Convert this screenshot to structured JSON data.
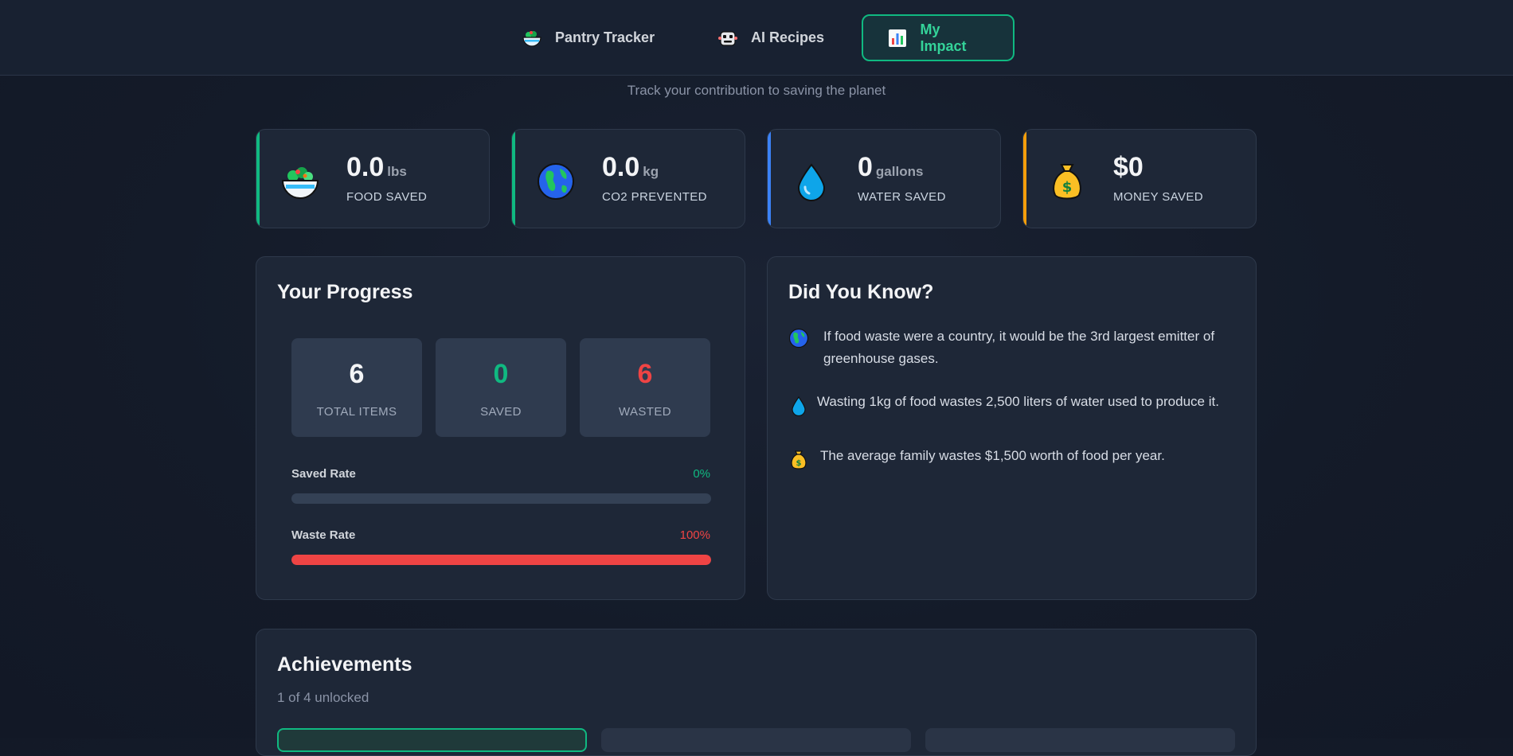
{
  "nav": {
    "items": [
      {
        "label": "Pantry Tracker",
        "icon": "salad-bowl-icon"
      },
      {
        "label": "AI Recipes",
        "icon": "robot-icon"
      },
      {
        "label": "My Impact",
        "icon": "bar-chart-icon",
        "active": true
      }
    ]
  },
  "header": {
    "subtitle": "Track your contribution to saving the planet"
  },
  "stats": [
    {
      "value": "0.0",
      "unit": "lbs",
      "label": "FOOD SAVED",
      "accent": "#10b981",
      "icon": "salad-bowl-icon"
    },
    {
      "value": "0.0",
      "unit": "kg",
      "label": "CO2 PREVENTED",
      "accent": "#10b981",
      "icon": "globe-icon"
    },
    {
      "value": "0",
      "unit": "gallons",
      "label": "WATER SAVED",
      "accent": "#3b82f6",
      "icon": "water-drop-icon"
    },
    {
      "value": "$0",
      "unit": "",
      "label": "MONEY SAVED",
      "accent": "#f59e0b",
      "icon": "money-bag-icon"
    }
  ],
  "progress": {
    "title": "Your Progress",
    "totals": [
      {
        "value": "6",
        "label": "TOTAL ITEMS",
        "color": "#f3f4f6"
      },
      {
        "value": "0",
        "label": "SAVED",
        "color": "#10b981"
      },
      {
        "value": "6",
        "label": "WASTED",
        "color": "#ef4444"
      }
    ],
    "saved_rate": {
      "label": "Saved Rate",
      "value": "0%",
      "fraction": 0,
      "color": "#10b981"
    },
    "waste_rate": {
      "label": "Waste Rate",
      "value": "100%",
      "fraction": 1.0,
      "color": "#ef4444"
    }
  },
  "facts": {
    "title": "Did You Know?",
    "items": [
      {
        "icon": "globe-icon",
        "text": "If food waste were a country, it would be the 3rd largest emitter of greenhouse gases."
      },
      {
        "icon": "water-drop-icon",
        "text": "Wasting 1kg of food wastes 2,500 liters of water used to produce it."
      },
      {
        "icon": "money-bag-icon",
        "text": "The average family wastes $1,500 worth of food per year."
      }
    ]
  },
  "achievements": {
    "title": "Achievements",
    "summary": "1 of 4 unlocked"
  },
  "colors": {
    "accent_green": "#10b981",
    "accent_red": "#ef4444",
    "accent_blue": "#3b82f6",
    "accent_orange": "#f59e0b"
  }
}
